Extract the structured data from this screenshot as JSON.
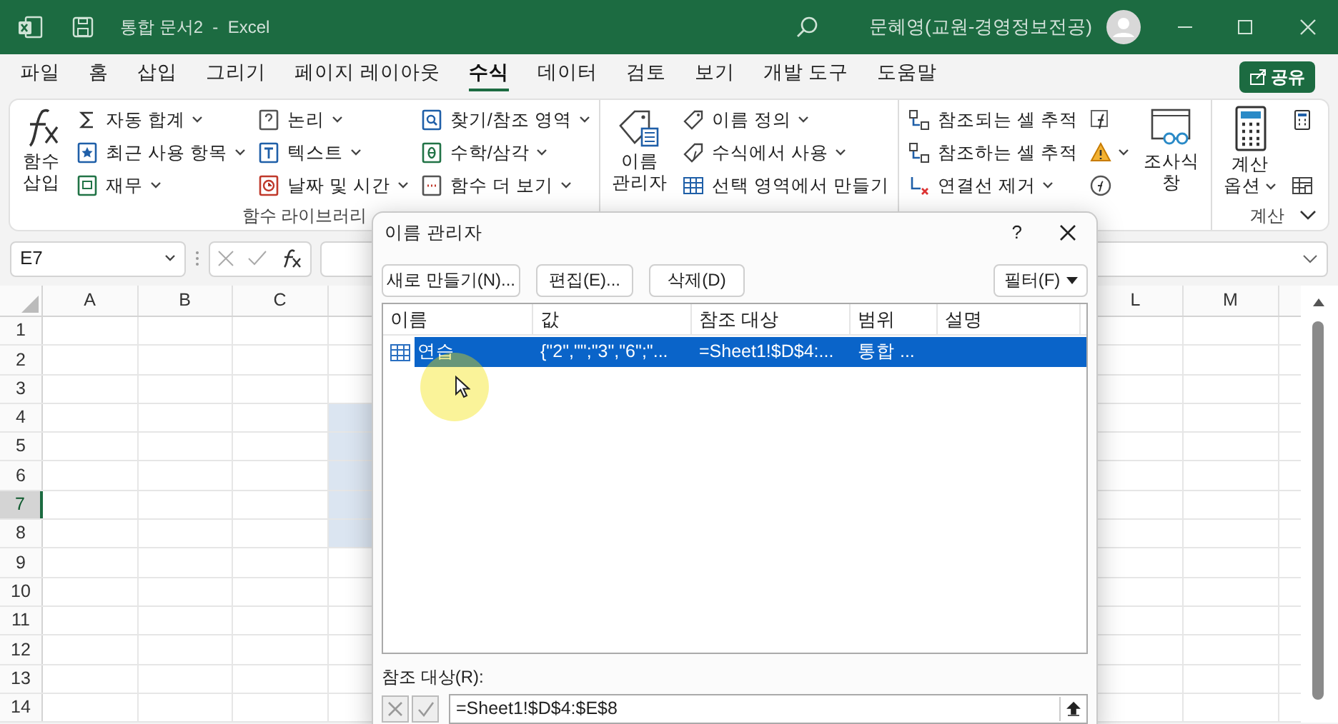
{
  "window": {
    "title": "통합 문서2  -  Excel",
    "user": "문혜영(교원-경영정보전공)"
  },
  "menu_tabs": [
    {
      "label": "파일",
      "selected": false
    },
    {
      "label": "홈",
      "selected": false
    },
    {
      "label": "삽입",
      "selected": false
    },
    {
      "label": "그리기",
      "selected": false
    },
    {
      "label": "페이지 레이아웃",
      "selected": false
    },
    {
      "label": "수식",
      "selected": true
    },
    {
      "label": "데이터",
      "selected": false
    },
    {
      "label": "검토",
      "selected": false
    },
    {
      "label": "보기",
      "selected": false
    },
    {
      "label": "개발 도구",
      "selected": false
    },
    {
      "label": "도움말",
      "selected": false
    }
  ],
  "share_button": "공유",
  "ribbon": {
    "groups": [
      {
        "label": "함수 라이브러리",
        "columns": [
          [
            {
              "kind": "large",
              "label": "함수 삽입",
              "dropdown": false
            }
          ],
          [
            {
              "kind": "small",
              "label": "자동 합계",
              "dropdown": true
            },
            {
              "kind": "small",
              "label": "최근 사용 항목",
              "dropdown": true
            },
            {
              "kind": "small",
              "label": "재무",
              "dropdown": true
            }
          ],
          [
            {
              "kind": "small",
              "label": "논리",
              "dropdown": true
            },
            {
              "kind": "small",
              "label": "텍스트",
              "dropdown": true
            },
            {
              "kind": "small",
              "label": "날짜 및 시간",
              "dropdown": true
            }
          ],
          [
            {
              "kind": "small",
              "label": "찾기/참조 영역",
              "dropdown": true
            },
            {
              "kind": "small",
              "label": "수학/삼각",
              "dropdown": true
            },
            {
              "kind": "small",
              "label": "함수 더 보기",
              "dropdown": true
            }
          ]
        ]
      },
      {
        "columns": [
          [
            {
              "kind": "large",
              "label": "이름 관리자",
              "dropdown": false
            }
          ],
          [
            {
              "kind": "small",
              "label": "이름 정의",
              "dropdown": true
            },
            {
              "kind": "small",
              "label": "수식에서 사용",
              "dropdown": true
            },
            {
              "kind": "small",
              "label": "선택 영역에서 만들기",
              "dropdown": false
            }
          ]
        ]
      },
      {
        "columns": [
          [
            {
              "kind": "small",
              "label": "참조되는 셀 추적",
              "dropdown": false
            },
            {
              "kind": "small",
              "label": "참조하는 셀 추적",
              "dropdown": false
            },
            {
              "kind": "small",
              "label": "연결선 제거",
              "dropdown": true
            }
          ],
          [
            {
              "kind": "icon",
              "dropdown": false
            },
            {
              "kind": "icon",
              "dropdown": true
            },
            {
              "kind": "icon",
              "dropdown": false
            }
          ],
          [
            {
              "kind": "large",
              "label": "조사식 창",
              "dropdown": false
            }
          ]
        ]
      },
      {
        "label": "계산",
        "columns": [
          [
            {
              "kind": "large",
              "label": "계산 옵션",
              "dropdown": true
            }
          ],
          [
            {
              "kind": "icon",
              "dropdown": false
            },
            {
              "kind": "icon",
              "dropdown": false
            }
          ]
        ]
      }
    ]
  },
  "formula_bar": {
    "name_box": "E7"
  },
  "sheet": {
    "columns_left": [
      "A",
      "B",
      "C"
    ],
    "columns_right": [
      "L",
      "M"
    ],
    "rows": [
      {
        "label": "1",
        "selected": false,
        "in_range": false
      },
      {
        "label": "2",
        "selected": false,
        "in_range": false
      },
      {
        "label": "3",
        "selected": false,
        "in_range": false
      },
      {
        "label": "4",
        "selected": false,
        "in_range": true
      },
      {
        "label": "5",
        "selected": false,
        "in_range": true
      },
      {
        "label": "6",
        "selected": false,
        "in_range": true
      },
      {
        "label": "7",
        "selected": true,
        "in_range": true
      },
      {
        "label": "8",
        "selected": false,
        "in_range": true
      },
      {
        "label": "9",
        "selected": false,
        "in_range": false
      },
      {
        "label": "10",
        "selected": false,
        "in_range": false
      },
      {
        "label": "11",
        "selected": false,
        "in_range": false
      },
      {
        "label": "12",
        "selected": false,
        "in_range": false
      },
      {
        "label": "13",
        "selected": false,
        "in_range": false
      },
      {
        "label": "14",
        "selected": false,
        "in_range": false
      }
    ]
  },
  "dialog": {
    "title": "이름 관리자",
    "help": "?",
    "buttons": [
      {
        "label": "새로 만들기(N)..."
      },
      {
        "label": "편집(E)..."
      },
      {
        "label": "삭제(D)"
      }
    ],
    "filter_button": "필터(F)",
    "columns": [
      "이름",
      "값",
      "참조 대상",
      "범위",
      "설명"
    ],
    "rows": [
      {
        "name": "연습",
        "value": "{\"2\",\"\";\"3\",\"6\";\"...",
        "refers_to": "=Sheet1!$D$4:...",
        "scope": "통합 ...",
        "selected": true
      }
    ],
    "refers_label": "참조 대상(R):",
    "refers_value": "=Sheet1!$D$4:$E$8"
  }
}
